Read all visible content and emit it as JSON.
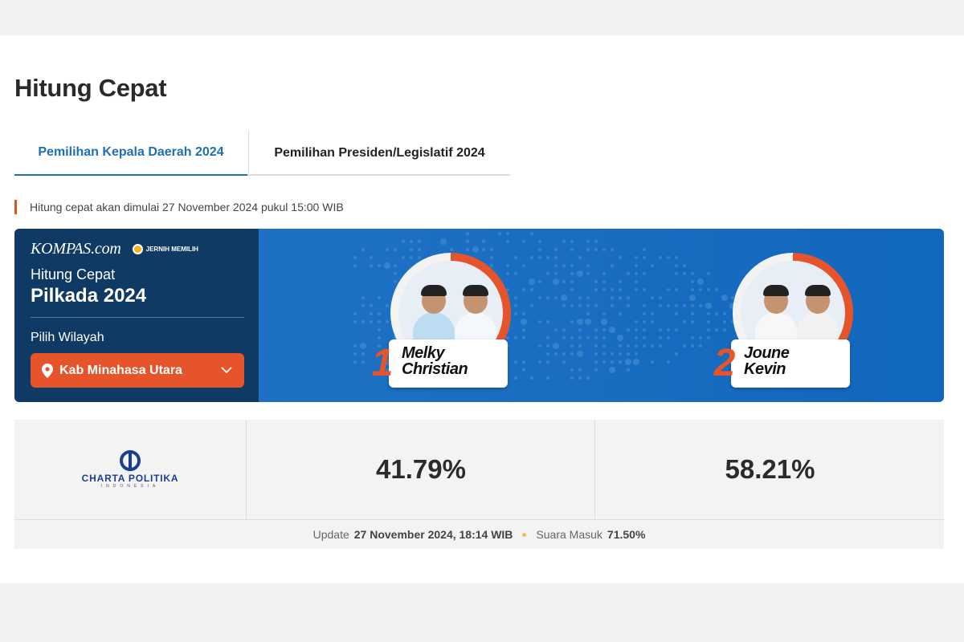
{
  "page": {
    "title": "Hitung Cepat"
  },
  "tabs": [
    {
      "label": "Pemilihan Kepala Daerah 2024",
      "active": true
    },
    {
      "label": "Pemilihan Presiden/Legislatif 2024",
      "active": false
    }
  ],
  "notice": "Hitung cepat akan dimulai 27 November 2024 pukul 15:00 WIB",
  "banner": {
    "brand": "KOMPAS.com",
    "partner_brand": "JERNIH MEMILIH",
    "subtitle": "Hitung Cepat",
    "title": "Pilkada 2024",
    "region_label": "Pilih Wilayah",
    "region_value": "Kab Minahasa Utara",
    "candidates": [
      {
        "number": "1",
        "name_line1": "Melky",
        "name_line2": "Christian"
      },
      {
        "number": "2",
        "name_line1": "Joune",
        "name_line2": "Kevin"
      }
    ]
  },
  "results": {
    "pollster": "CHARTA POLITIKA",
    "pollster_sub": "INDONESIA",
    "candidate1_pct": "41.79%",
    "candidate2_pct": "58.21%",
    "update_label": "Update",
    "update_time": "27 November 2024, 18:14 WIB",
    "votes_label": "Suara Masuk",
    "votes_value": "71.50%"
  },
  "colors": {
    "accent": "#1e6fb5",
    "orange": "#e5542a",
    "navy": "#0f3a63",
    "banner_blue": "#1a6dc0"
  }
}
